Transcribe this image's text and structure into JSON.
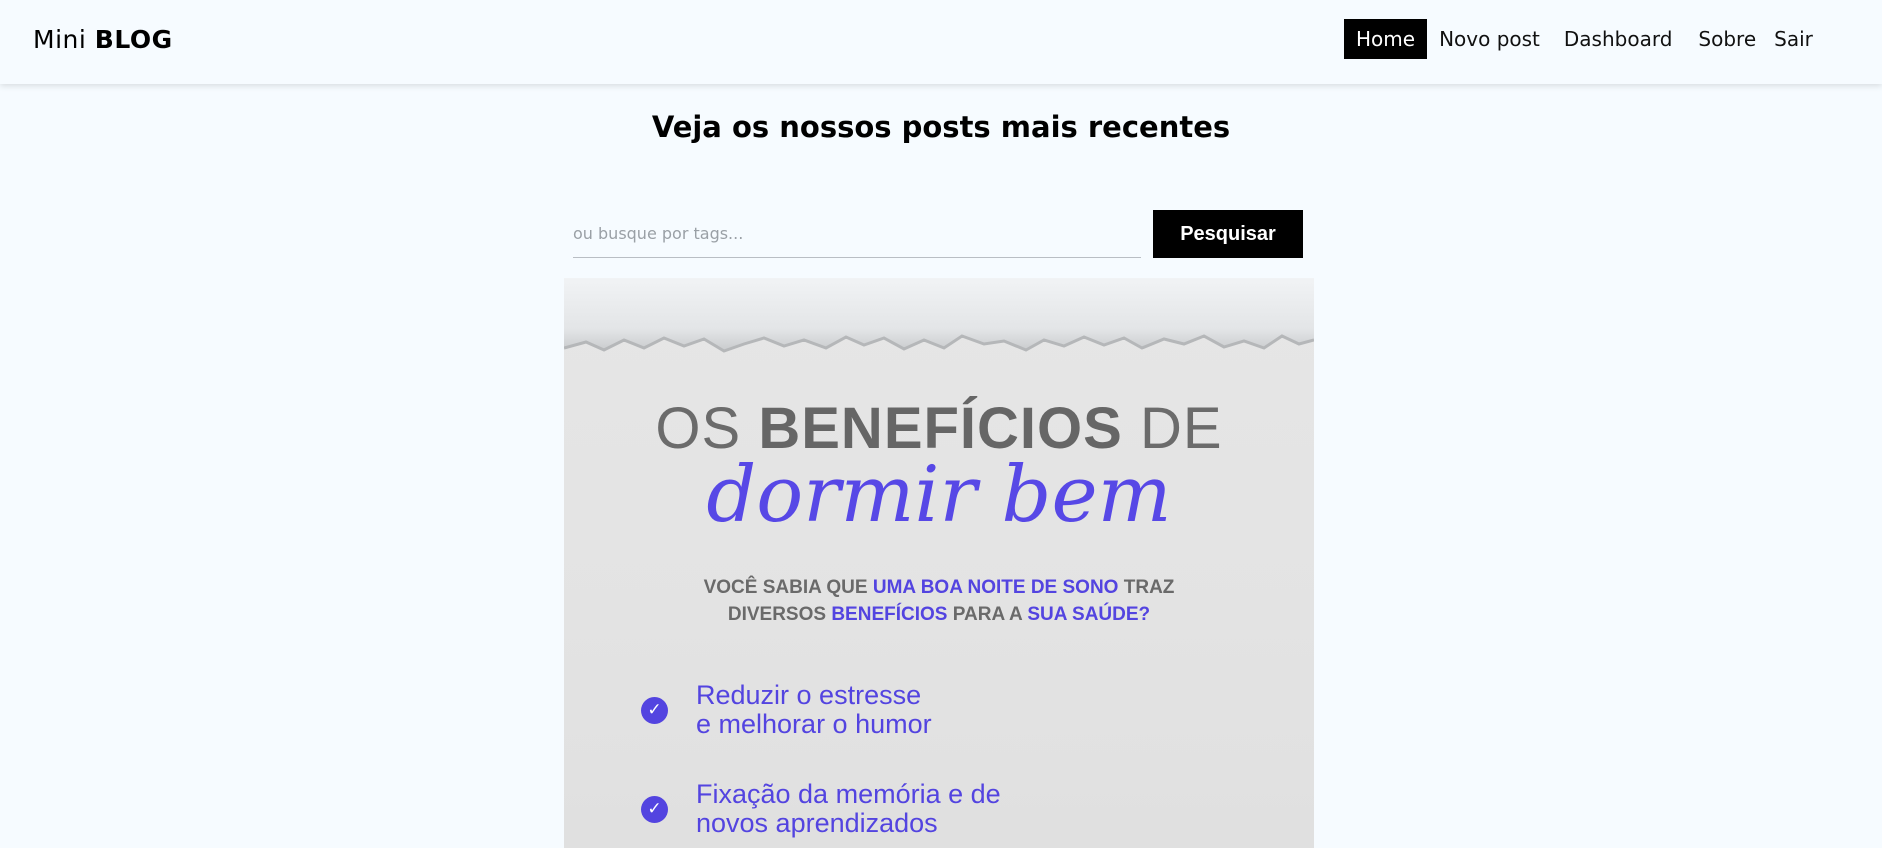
{
  "navbar": {
    "brand_regular": "Mini",
    "brand_bold": "BLOG",
    "links": [
      {
        "label": "Home",
        "active": true
      },
      {
        "label": "Novo post",
        "active": false
      },
      {
        "label": "Dashboard",
        "active": false
      },
      {
        "label": "Sobre",
        "active": false
      },
      {
        "label": "Sair",
        "active": false
      }
    ]
  },
  "main": {
    "title": "Veja os nossos posts mais recentes",
    "search": {
      "placeholder": "ou busque por tags...",
      "value": "",
      "button_label": "Pesquisar"
    }
  },
  "post": {
    "image": {
      "title_prefix": "OS",
      "title_bold": "BENEFÍCIOS",
      "title_suffix": "DE",
      "script_title": "dormir bem",
      "question_1": "VOCÊ SABIA QUE",
      "question_2": "UMA BOA NOITE DE SONO",
      "question_3": "TRAZ",
      "question_4": "DIVERSOS",
      "question_5": "BENEFÍCIOS",
      "question_6": "PARA A",
      "question_7": "SUA SAÚDE?",
      "benefits": [
        {
          "line1": "Reduzir o estresse",
          "line2": "e melhorar o humor"
        },
        {
          "line1": "Fixação da memória e de",
          "line2": "novos aprendizados"
        }
      ]
    }
  },
  "colors": {
    "background": "#f6fbff",
    "accent_purple": "#5344e0",
    "active_nav": "#000000"
  },
  "icons": {
    "benefit_marker": "check-circle-icon"
  }
}
